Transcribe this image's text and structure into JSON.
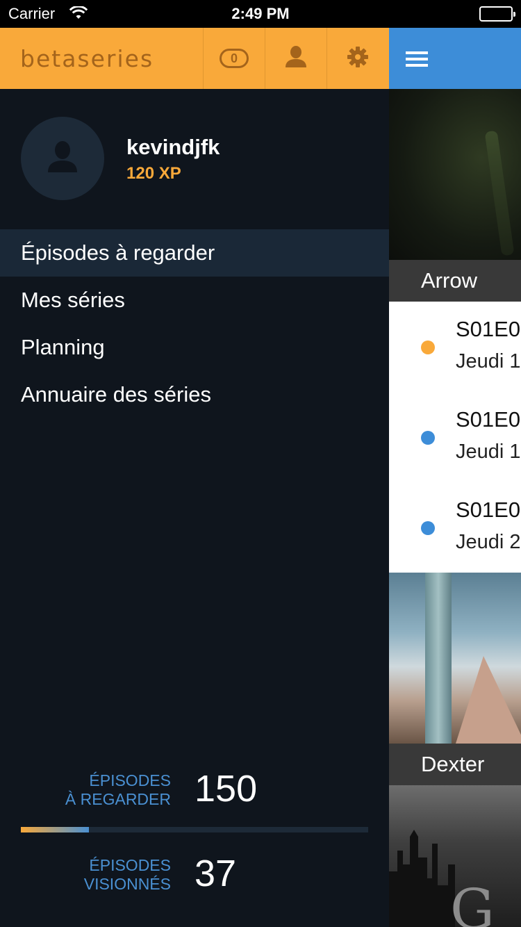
{
  "status_bar": {
    "carrier": "Carrier",
    "time": "2:49 PM"
  },
  "drawer": {
    "logo": "betaseries",
    "notification_count": "0",
    "icons": {
      "user": "user-icon",
      "settings": "gear-icon"
    },
    "profile": {
      "username": "kevindjfk",
      "xp": "120 XP"
    },
    "menu": [
      {
        "label": "Épisodes à regarder",
        "active": true
      },
      {
        "label": "Mes séries",
        "active": false
      },
      {
        "label": "Planning",
        "active": false
      },
      {
        "label": "Annuaire des séries",
        "active": false
      }
    ],
    "stats": {
      "to_watch": {
        "label_line1": "ÉPISODES",
        "label_line2": "À REGARDER",
        "value": "150"
      },
      "watched": {
        "label_line1": "ÉPISODES",
        "label_line2": "VISIONNÉS",
        "value": "37"
      },
      "progress_fraction": 0.196
    }
  },
  "content": {
    "shows": [
      {
        "name": "Arrow",
        "episodes": [
          {
            "code": "S01E0",
            "date": "Jeudi 1",
            "status_color": "#f9a93a"
          },
          {
            "code": "S01E0",
            "date": "Jeudi 1",
            "status_color": "#3d8dd8"
          },
          {
            "code": "S01E0",
            "date": "Jeudi 2",
            "status_color": "#3d8dd8"
          }
        ]
      },
      {
        "name": "Dexter"
      },
      {
        "name": "G"
      }
    ]
  },
  "colors": {
    "accent_orange": "#f9a93a",
    "accent_blue": "#3d8dd8",
    "drawer_bg": "#0f151d"
  }
}
